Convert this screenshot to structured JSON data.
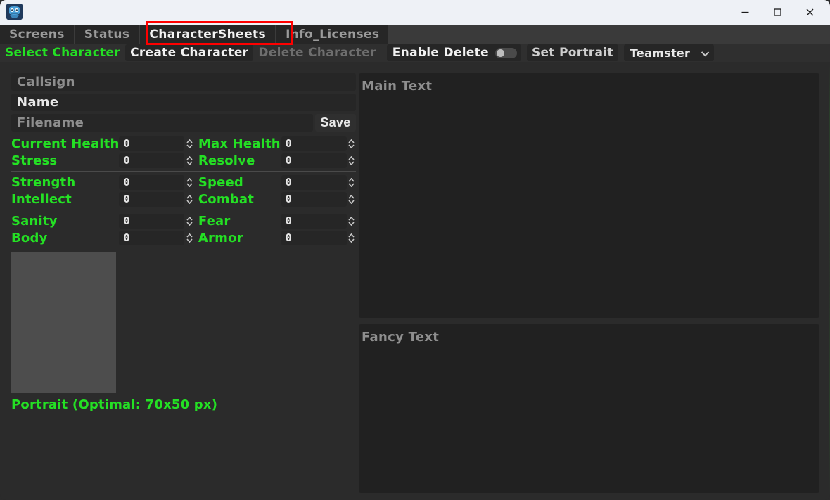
{
  "window": {
    "app_icon": "godot-robot-icon",
    "controls": {
      "minimize": "minimize-icon",
      "maximize": "maximize-icon",
      "close": "close-icon"
    }
  },
  "tabs": [
    {
      "label": "Screens",
      "active": false
    },
    {
      "label": "Status",
      "active": false
    },
    {
      "label": "CharacterSheets",
      "active": true
    },
    {
      "label": "Info_Licenses",
      "active": false
    }
  ],
  "toolbar": {
    "select_character": "Select Character",
    "create_character": "Create Character",
    "delete_character": "Delete Character",
    "enable_delete": "Enable Delete",
    "enable_delete_state": "off",
    "set_portrait": "Set Portrait",
    "class_select_value": "Teamster",
    "class_select_options": [
      "Teamster"
    ],
    "chevron": "chevron-down-icon"
  },
  "left_pane": {
    "callsign_placeholder": "Callsign",
    "callsign_value": "",
    "name_value": "Name",
    "filename_placeholder": "Filename",
    "filename_value": "",
    "save_label": "Save",
    "stat_groups": [
      {
        "rows": [
          {
            "left_label": "Current Health",
            "left_value": "0",
            "right_label": "Max Health",
            "right_value": "0"
          },
          {
            "left_label": "Stress",
            "left_value": "0",
            "right_label": "Resolve",
            "right_value": "0"
          }
        ]
      },
      {
        "rows": [
          {
            "left_label": "Strength",
            "left_value": "0",
            "right_label": "Speed",
            "right_value": "0"
          },
          {
            "left_label": "Intellect",
            "left_value": "0",
            "right_label": "Combat",
            "right_value": "0"
          }
        ]
      },
      {
        "rows": [
          {
            "left_label": "Sanity",
            "left_value": "0",
            "right_label": "Fear",
            "right_value": "0"
          },
          {
            "left_label": "Body",
            "left_value": "0",
            "right_label": "Armor",
            "right_value": "0"
          }
        ]
      }
    ],
    "portrait_caption": "Portrait (Optimal: 70x50 px)",
    "portrait_image": ""
  },
  "right_pane": {
    "main_text_placeholder": "Main Text",
    "main_text_value": "",
    "fancy_text_placeholder": "Fancy Text",
    "fancy_text_value": ""
  },
  "colors": {
    "accent_green": "#24e024",
    "panel_bg": "#2b2b2b",
    "field_bg": "#262626",
    "textarea_bg": "#212121",
    "titlebar_bg": "#eef1f6",
    "highlight_red": "#ff0000",
    "placeholder_gray": "#8e8e8e",
    "disabled_gray": "#6e6e6e"
  }
}
